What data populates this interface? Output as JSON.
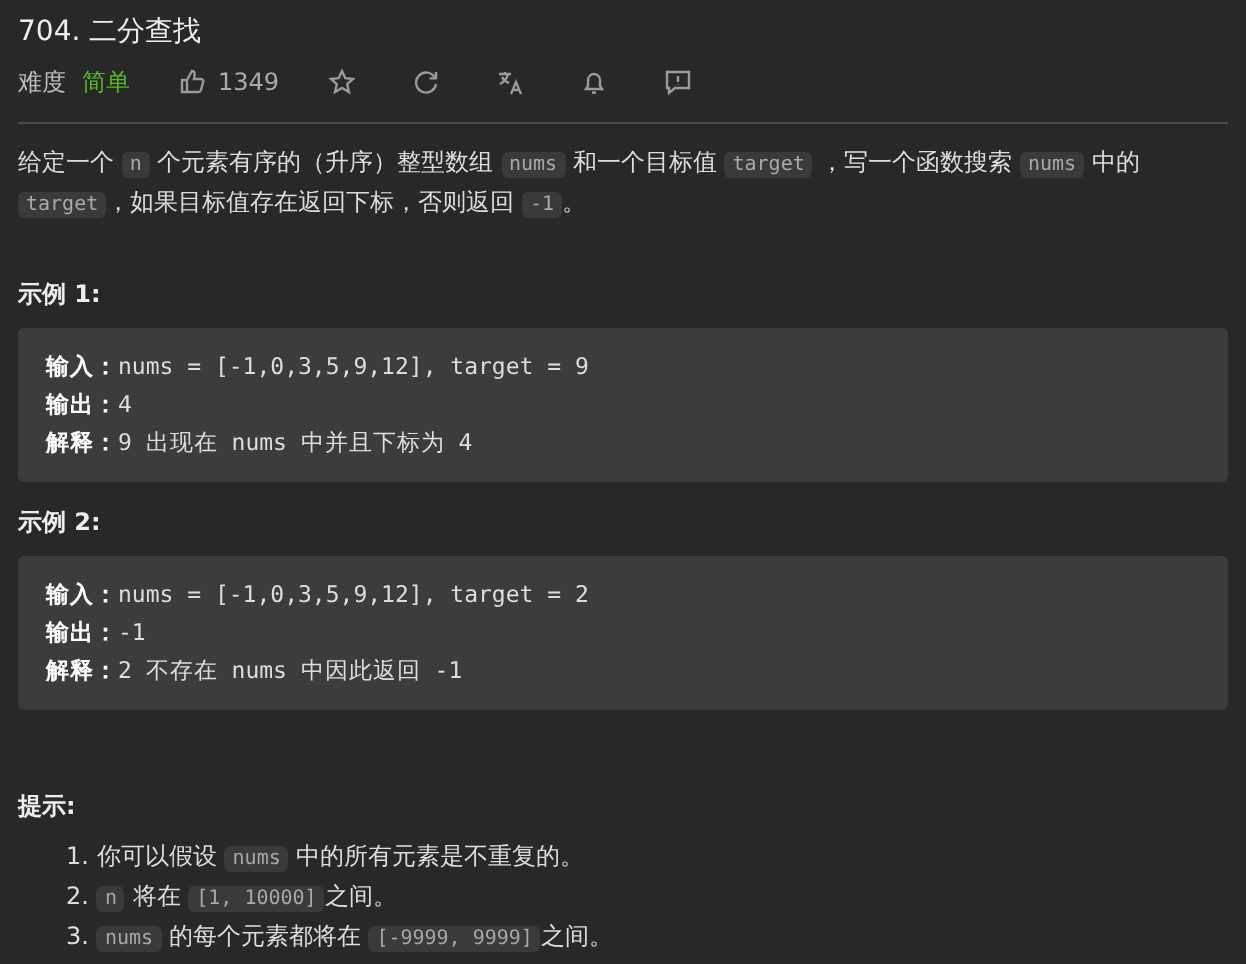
{
  "title": "704. 二分查找",
  "meta": {
    "difficulty_label": "难度",
    "difficulty": "简单",
    "likes": "1349"
  },
  "description": [
    [
      {
        "kind": "text",
        "text": "给定一个 "
      },
      {
        "kind": "code",
        "text": "n"
      },
      {
        "kind": "text",
        "text": " 个元素有序的（升序）整型数组 "
      },
      {
        "kind": "code",
        "text": "nums"
      },
      {
        "kind": "text",
        "text": " 和一个目标值 "
      },
      {
        "kind": "code",
        "text": "target"
      },
      {
        "kind": "text",
        "text": " ，写一个函数搜索 "
      },
      {
        "kind": "code",
        "text": "nums"
      },
      {
        "kind": "text",
        "text": " 中的 "
      },
      {
        "kind": "code",
        "text": "target"
      },
      {
        "kind": "text",
        "text": "，如果目标值存在返回下标，否则返回 "
      },
      {
        "kind": "code",
        "text": "-1"
      },
      {
        "kind": "text",
        "text": "。"
      }
    ]
  ],
  "examples": [
    {
      "title": "示例 1:",
      "lines": [
        {
          "label": "输入：",
          "value": "nums = [-1,0,3,5,9,12], target = 9"
        },
        {
          "label": "输出：",
          "value": "4"
        },
        {
          "label": "解释：",
          "value": "9 出现在 nums 中并且下标为 4"
        }
      ]
    },
    {
      "title": "示例 2:",
      "lines": [
        {
          "label": "输入：",
          "value": "nums = [-1,0,3,5,9,12], target = 2"
        },
        {
          "label": "输出：",
          "value": "-1"
        },
        {
          "label": "解释：",
          "value": "2 不存在 nums 中因此返回 -1"
        }
      ]
    }
  ],
  "hints": {
    "title": "提示:",
    "items": [
      {
        "number": "1.",
        "parts": [
          {
            "kind": "text",
            "text": "你可以假设 "
          },
          {
            "kind": "code",
            "text": "nums"
          },
          {
            "kind": "text",
            "text": " 中的所有元素是不重复的。"
          }
        ]
      },
      {
        "number": "2.",
        "parts": [
          {
            "kind": "code",
            "text": "n"
          },
          {
            "kind": "text",
            "text": " 将在 "
          },
          {
            "kind": "code",
            "text": "[1, 10000]"
          },
          {
            "kind": "text",
            "text": "之间。"
          }
        ]
      },
      {
        "number": "3.",
        "parts": [
          {
            "kind": "code",
            "text": "nums"
          },
          {
            "kind": "text",
            "text": " 的每个元素都将在 "
          },
          {
            "kind": "code",
            "text": "[-9999, 9999]"
          },
          {
            "kind": "text",
            "text": "之间。"
          }
        ]
      }
    ]
  }
}
